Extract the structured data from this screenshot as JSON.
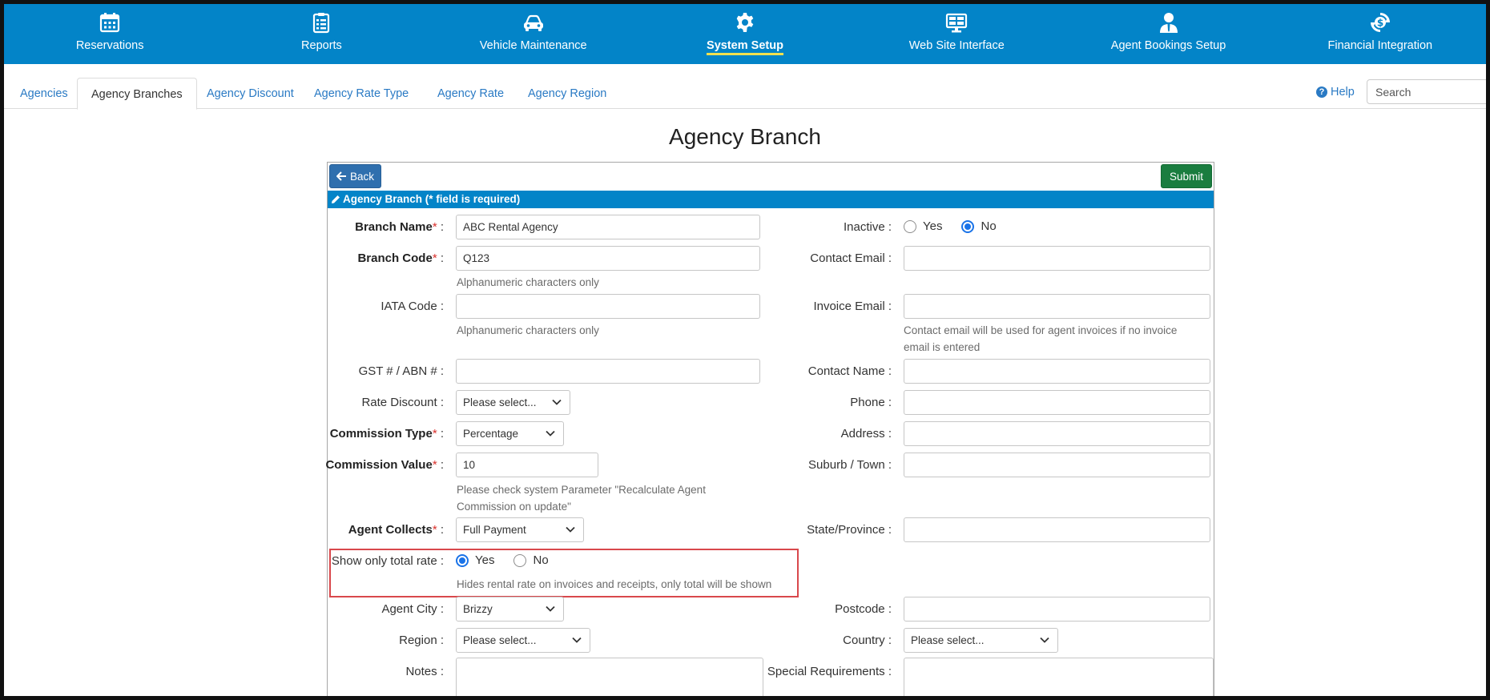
{
  "nav": {
    "items": [
      {
        "label": "Reservations",
        "icon": "calendar-icon"
      },
      {
        "label": "Reports",
        "icon": "clipboard-icon"
      },
      {
        "label": "Vehicle Maintenance",
        "icon": "car-icon"
      },
      {
        "label": "System Setup",
        "icon": "gear-icon"
      },
      {
        "label": "Web Site Interface",
        "icon": "monitor-icon"
      },
      {
        "label": "Agent Bookings Setup",
        "icon": "agent-icon"
      },
      {
        "label": "Financial Integration",
        "icon": "dollar-refresh-icon"
      }
    ],
    "active": "System Setup"
  },
  "tabs": {
    "agencies": "Agencies",
    "branches": "Agency Branches",
    "discount": "Agency Discount",
    "rate_type": "Agency Rate Type",
    "rate": "Agency Rate",
    "region": "Agency Region",
    "active": "Agency Branches"
  },
  "header": {
    "help": "Help",
    "search_placeholder": "Search"
  },
  "page": {
    "title": "Agency Branch",
    "back": "Back",
    "submit": "Submit",
    "panel_heading": "Agency Branch (* field is required)"
  },
  "form": {
    "branch_name": {
      "label": "Branch Name",
      "value": "ABC Rental Agency"
    },
    "branch_code": {
      "label": "Branch Code",
      "value": "Q123",
      "hint": "Alphanumeric characters only"
    },
    "iata_code": {
      "label": "IATA Code :",
      "value": "",
      "hint": "Alphanumeric characters only"
    },
    "gst": {
      "label": "GST # / ABN # :",
      "value": ""
    },
    "rate_discount": {
      "label": "Rate Discount :",
      "value": "Please select..."
    },
    "commission_type": {
      "label": "Commission Type",
      "value": "Percentage"
    },
    "commission_value": {
      "label": "Commission Value",
      "value": "10",
      "hint_line1": "Please check system Parameter \"Recalculate Agent",
      "hint_line2": "Commission on update\""
    },
    "agent_collects": {
      "label": "Agent Collects",
      "value": "Full Payment"
    },
    "show_total_rate": {
      "label": "Show only total rate :",
      "yes": "Yes",
      "no": "No",
      "selected": "Yes",
      "hint": "Hides rental rate on invoices and receipts, only total will be shown"
    },
    "agent_city": {
      "label": "Agent City :",
      "value": "Brizzy"
    },
    "region": {
      "label": "Region :",
      "value": "Please select..."
    },
    "notes": {
      "label": "Notes :",
      "value": ""
    },
    "inactive": {
      "label": "Inactive :",
      "yes": "Yes",
      "no": "No",
      "selected": "No"
    },
    "contact_email": {
      "label": "Contact Email :",
      "value": ""
    },
    "invoice_email": {
      "label": "Invoice Email :",
      "value": "",
      "hint_line1": "Contact email will be used for agent invoices if no invoice",
      "hint_line2": "email is entered"
    },
    "contact_name": {
      "label": "Contact Name :",
      "value": ""
    },
    "phone": {
      "label": "Phone :",
      "value": ""
    },
    "address": {
      "label": "Address :",
      "value": ""
    },
    "suburb": {
      "label": "Suburb / Town :",
      "value": ""
    },
    "state": {
      "label": "State/Province :",
      "value": ""
    },
    "postcode": {
      "label": "Postcode :",
      "value": ""
    },
    "country": {
      "label": "Country :",
      "value": "Please select..."
    },
    "special_requirements": {
      "label": "Special Requirements :",
      "value": ""
    }
  },
  "colors": {
    "nav_bg": "#0384c8",
    "active_underline": "#f1e04f",
    "submit": "#1a7d3f",
    "back": "#2f6fae",
    "required": "#d9302c",
    "highlight": "#d9484c"
  }
}
